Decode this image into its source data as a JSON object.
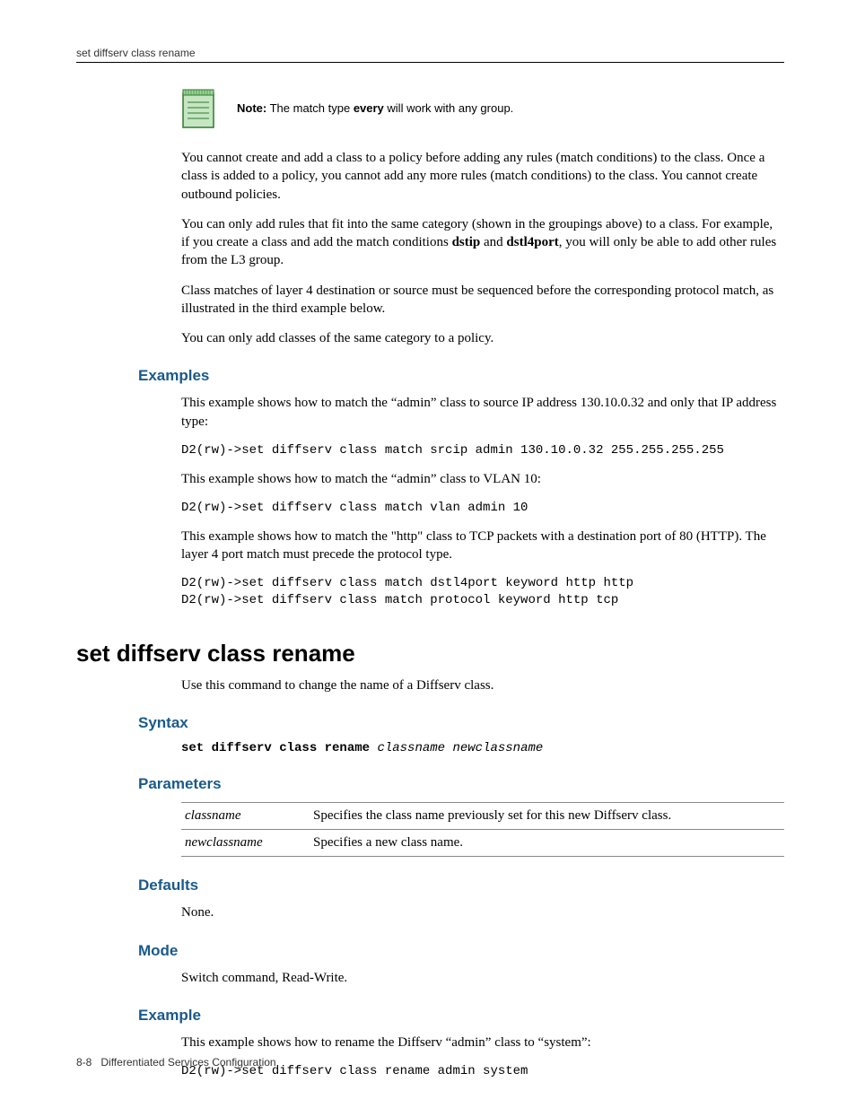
{
  "header": {
    "running_head": "set diffserv class rename"
  },
  "note": {
    "prefix": "Note:",
    "text_before": " The match type ",
    "bold": "every",
    "text_after": " will work with any group."
  },
  "para1": {
    "text": "You cannot create and add a class to a policy before adding any rules (match conditions) to the class. Once a class is added to a policy, you cannot add any more rules (match conditions) to the class. You cannot create outbound policies."
  },
  "para2": {
    "a": "You can only add rules that fit into the same category (shown in the groupings above) to a class. For example, if you create a class and add the match conditions ",
    "b1": "dstip",
    "mid": " and ",
    "b2": "dstl4port",
    "c": ", you will only be able to add other rules from the L3 group."
  },
  "para3": "Class matches of layer 4 destination or source must be sequenced before the corresponding protocol match, as illustrated in the third example below.",
  "para4": "You can only add classes of the same category to a policy.",
  "examples": {
    "heading": "Examples",
    "p1": "This example shows how to match the “admin” class to source IP address 130.10.0.32 and only that IP address type:",
    "c1": "D2(rw)->set diffserv class match srcip admin 130.10.0.32 255.255.255.255",
    "p2": "This example shows how to match the “admin” class to VLAN 10:",
    "c2": "D2(rw)->set diffserv class match vlan admin 10",
    "p3": "This example shows how to match the \"http\" class to TCP packets with a destination port of 80 (HTTP). The layer 4 port match must precede the protocol type.",
    "c3": "D2(rw)->set diffserv class match dstl4port keyword http http\nD2(rw)->set diffserv class match protocol keyword http tcp"
  },
  "command": {
    "title": "set diffserv class rename",
    "desc": "Use this command to change the name of a Diffserv class."
  },
  "syntax": {
    "heading": "Syntax",
    "cmd": "set diffserv class rename",
    "args": "classname newclassname"
  },
  "parameters": {
    "heading": "Parameters",
    "rows": [
      {
        "name": "classname",
        "desc": "Specifies the class name previously set for this new Diffserv class."
      },
      {
        "name": "newclassname",
        "desc": "Specifies a new class name."
      }
    ]
  },
  "defaults": {
    "heading": "Defaults",
    "text": "None."
  },
  "mode": {
    "heading": "Mode",
    "text": "Switch command, Read-Write."
  },
  "example2": {
    "heading": "Example",
    "text": "This example shows how to rename the Diffserv “admin” class to “system”:",
    "code": "D2(rw)->set diffserv class rename admin system"
  },
  "footer": {
    "page": "8-8",
    "title": "Differentiated Services Configuration"
  }
}
